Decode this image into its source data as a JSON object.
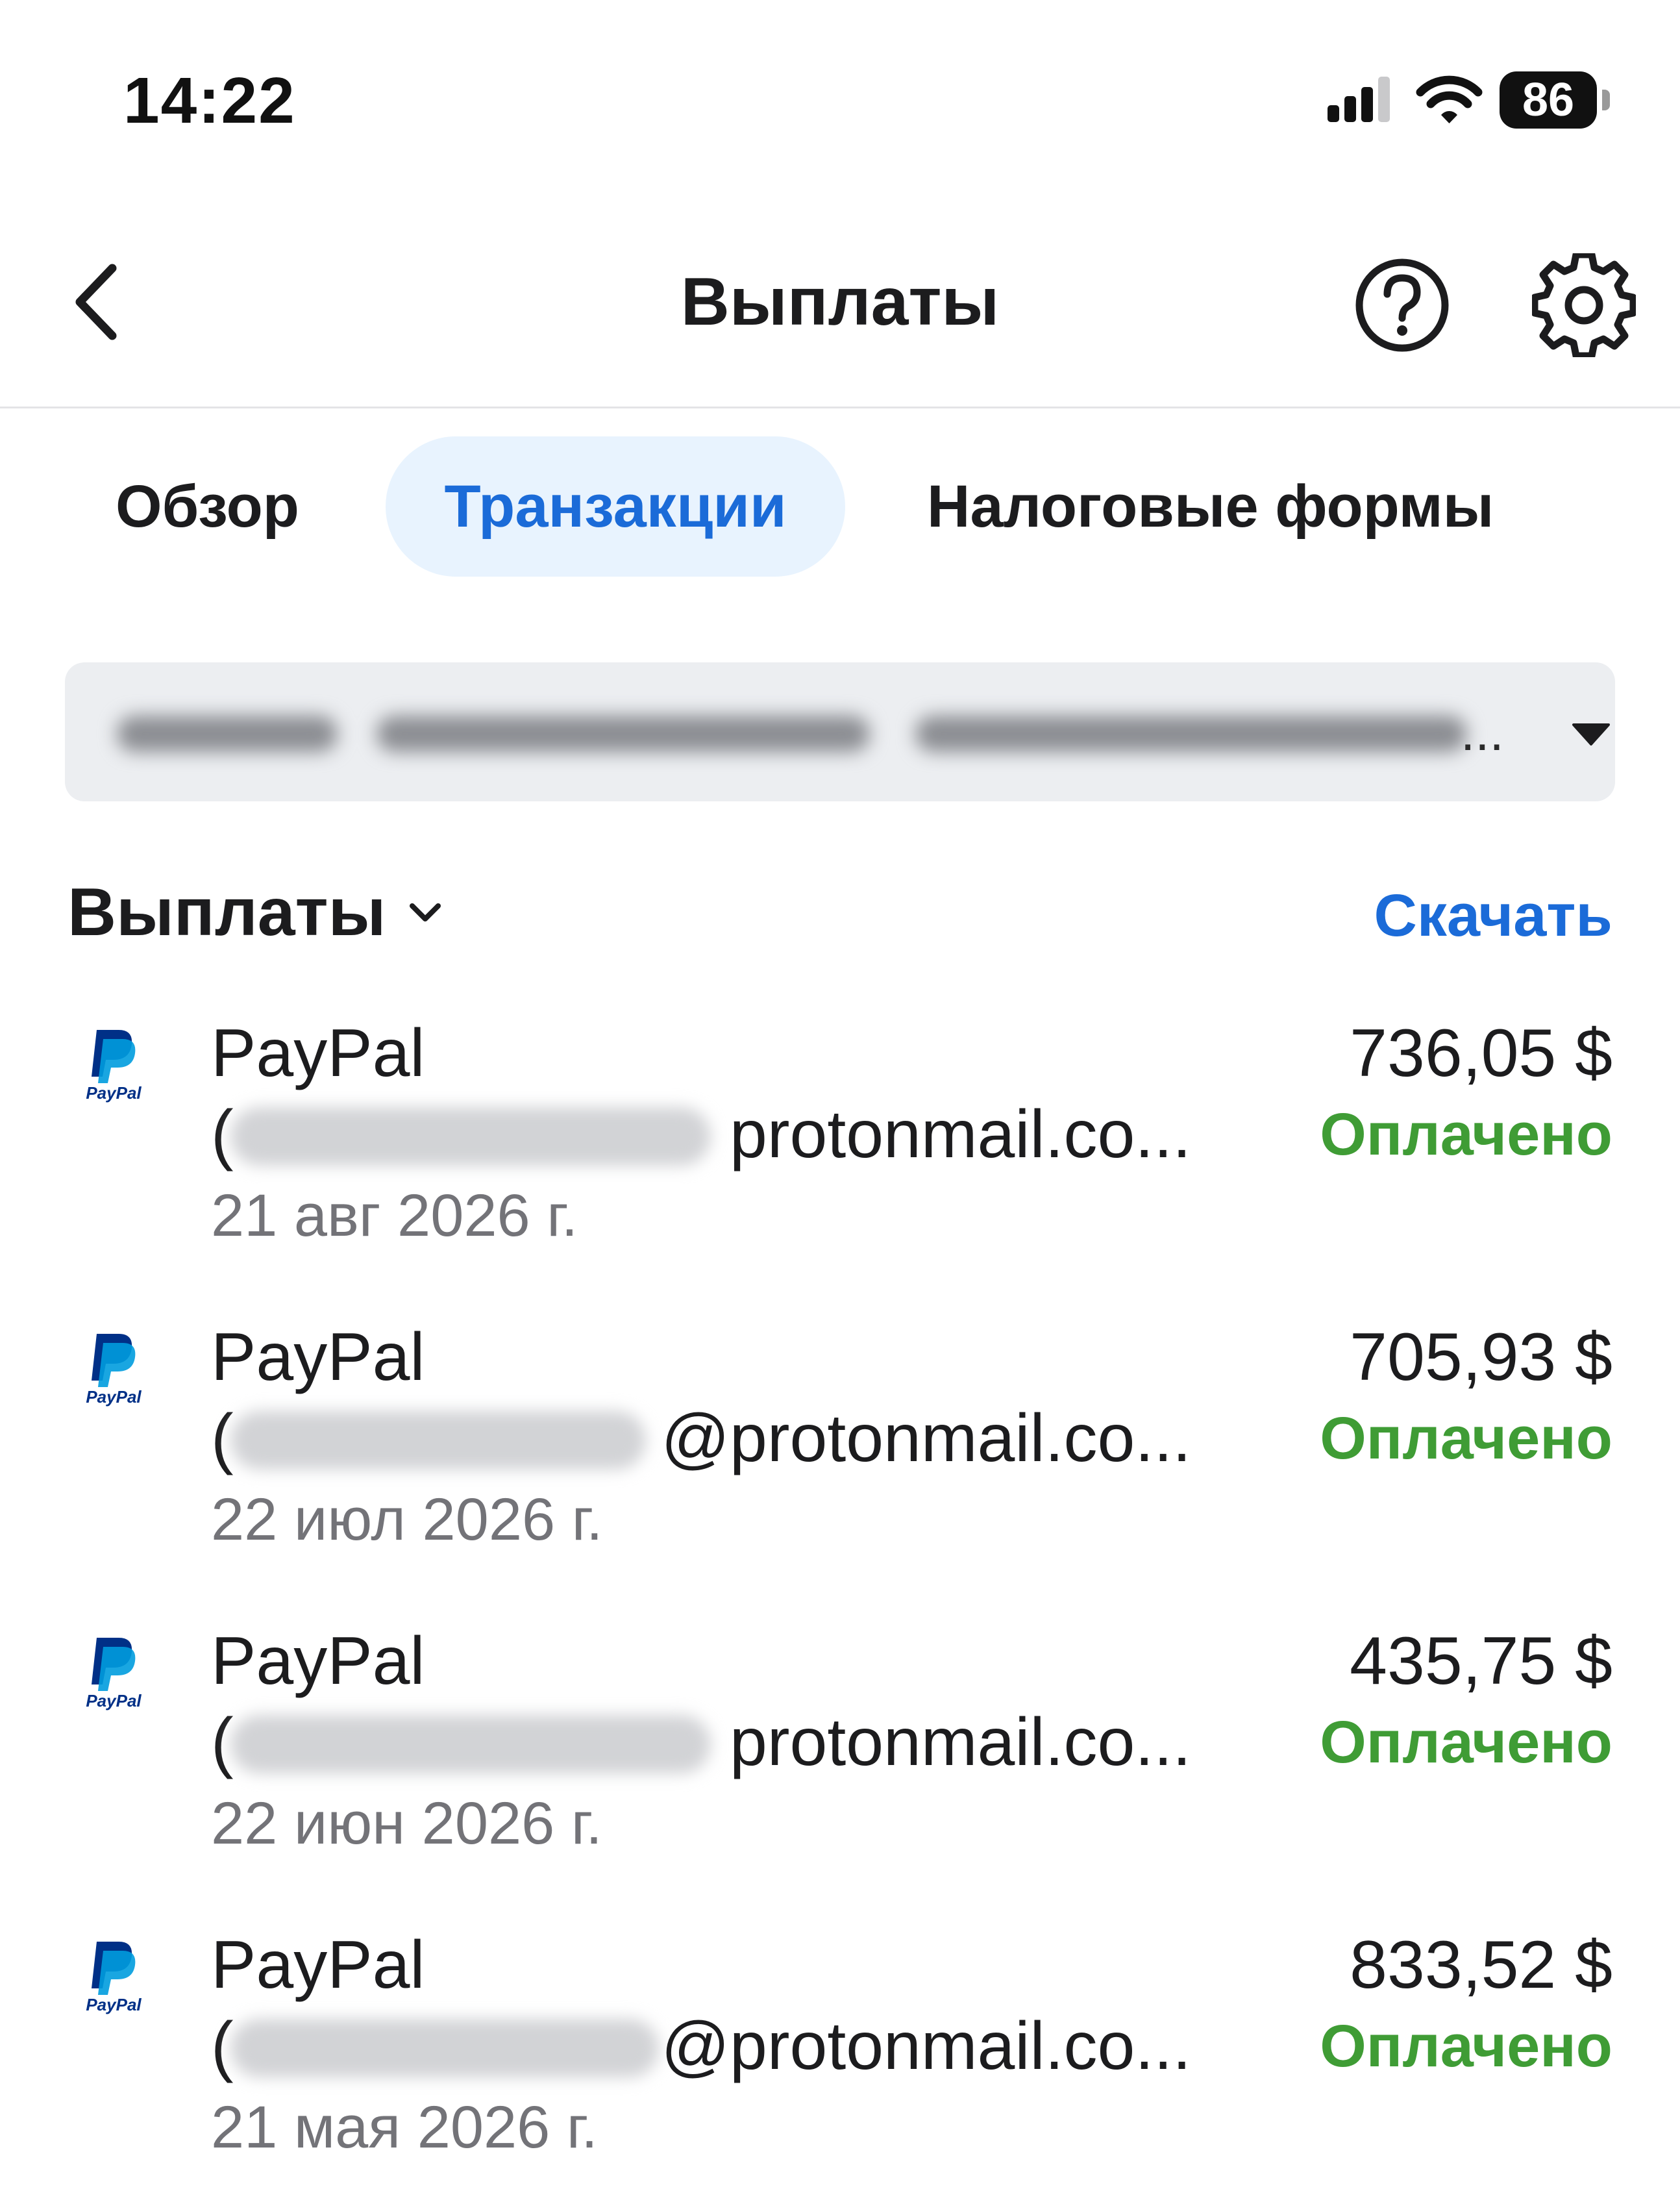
{
  "status_bar": {
    "time": "14:22",
    "battery_level": "86",
    "icons": [
      "cellular-signal-icon",
      "wifi-icon",
      "battery-icon"
    ]
  },
  "nav": {
    "title": "Выплаты",
    "icons": [
      "back-chevron-icon",
      "help-icon",
      "gear-icon"
    ]
  },
  "tabs": [
    {
      "label": "Обзор",
      "selected": false
    },
    {
      "label": "Транзакции",
      "selected": true
    },
    {
      "label": "Налоговые формы",
      "selected": false
    }
  ],
  "account_select": {
    "value": "..."
  },
  "section": {
    "title": "Выплаты",
    "download_label": "Скачать"
  },
  "payouts": [
    {
      "method": "PayPal",
      "email_prefix": "(",
      "email_visible": "protonmail.co...",
      "date": "21 авг 2026 г.",
      "amount": "736,05 $",
      "status": "Оплачено"
    },
    {
      "method": "PayPal",
      "email_prefix": "(",
      "email_visible": "@protonmail.co...",
      "date": "22 июл 2026 г.",
      "amount": "705,93 $",
      "status": "Оплачено"
    },
    {
      "method": "PayPal",
      "email_prefix": "(",
      "email_visible": "protonmail.co...",
      "date": "22 июн 2026 г.",
      "amount": "435,75 $",
      "status": "Оплачено"
    },
    {
      "method": "PayPal",
      "email_prefix": "(",
      "email_visible": "@protonmail.co...",
      "date": "21 мая 2026 г.",
      "amount": "833,52 $",
      "status": "Оплачено"
    }
  ],
  "colors": {
    "accent": "#1b6bd8",
    "tab_selected_bg": "#e8f3fe",
    "status_paid": "#3f9c35",
    "paypal_dark": "#003087",
    "paypal_light": "#009cde"
  }
}
